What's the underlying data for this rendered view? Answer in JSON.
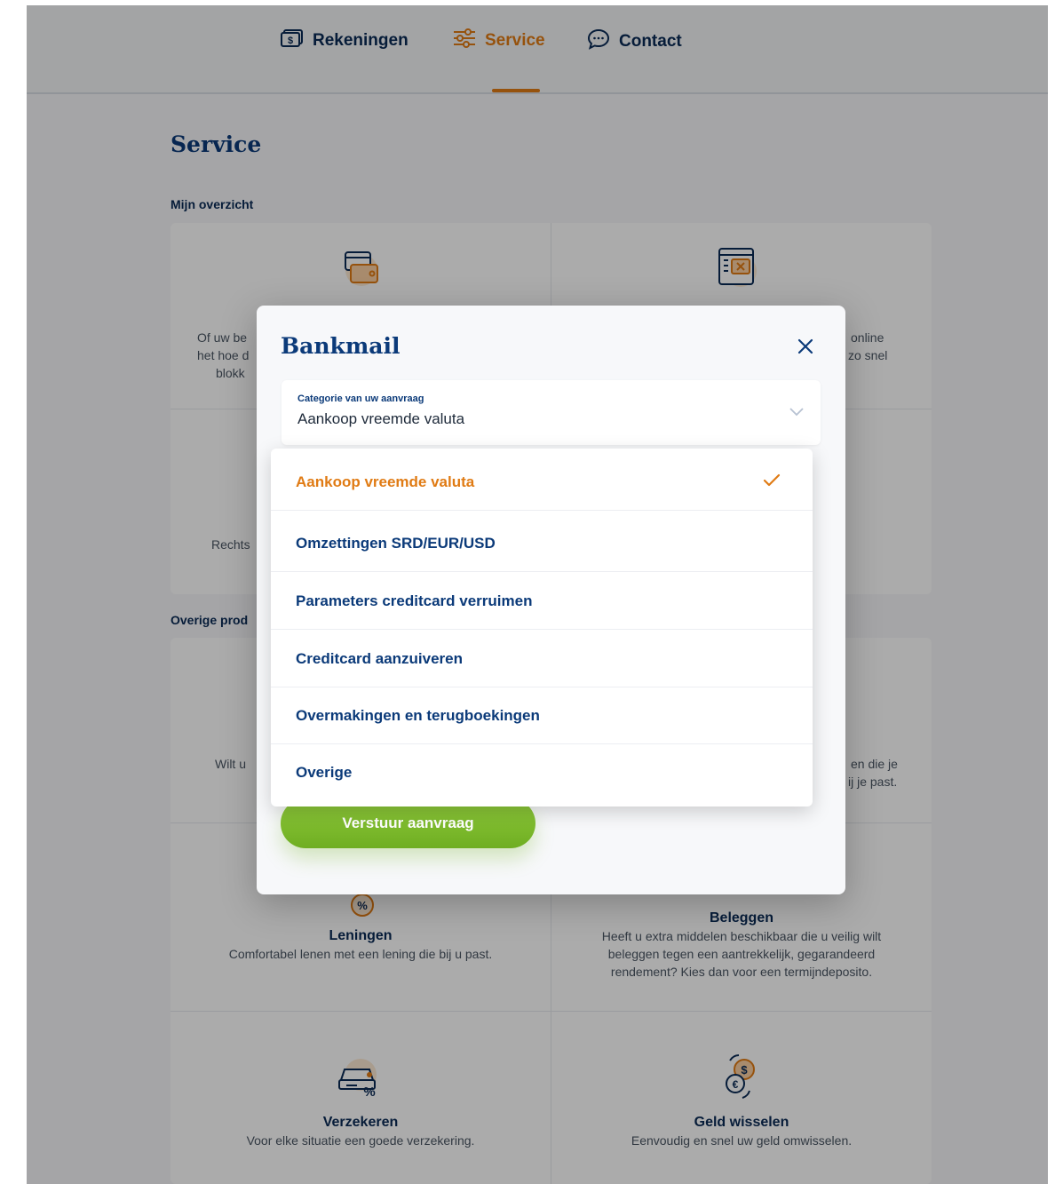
{
  "nav": {
    "items": [
      {
        "label": "Rekeningen",
        "icon": "bank-note-icon",
        "active": false
      },
      {
        "label": "Service",
        "icon": "sliders-icon",
        "active": true
      },
      {
        "label": "Contact",
        "icon": "chat-bubble-icon",
        "active": false
      }
    ],
    "accent_color": "#e07b14"
  },
  "page": {
    "title": "Service",
    "sections": {
      "overview": "Mijn overzicht",
      "other_products": "Overige prod"
    },
    "overview_cards": {
      "left_fragment_1": "Of uw be",
      "left_fragment_2": "het hoe d",
      "left_fragment_3": "blokk",
      "right_fragment_1": "online",
      "right_fragment_2": "zo snel",
      "left_fragment_4": "Rechts"
    },
    "other_cards": {
      "left_fragment": "Wilt u",
      "right_fragment_1": "en die je",
      "right_fragment_2": "ij je past."
    },
    "products": [
      {
        "title": "Leningen",
        "desc": "Comfortabel lenen met een lening die bij u past.",
        "icon": "percent-icon"
      },
      {
        "title": "Beleggen",
        "desc_1": "Heeft u extra middelen beschikbaar die u veilig wilt",
        "desc_2": "beleggen tegen een aantrekkelijk, gegarandeerd",
        "desc_3": "rendement? Kies dan voor een termijndeposito.",
        "icon": "investment-icon"
      },
      {
        "title": "Verzekeren",
        "desc": "Voor elke situatie een goede verzekering.",
        "icon": "car-insurance-icon"
      },
      {
        "title": "Geld wisselen",
        "desc": "Eenvoudig en snel uw geld omwisselen.",
        "icon": "currency-exchange-icon"
      }
    ]
  },
  "modal": {
    "title": "Bankmail",
    "select": {
      "label": "Categorie van uw aanvraag",
      "value": "Aankoop vreemde valuta"
    },
    "options": [
      {
        "label": "Aankoop vreemde valuta",
        "selected": true
      },
      {
        "label": "Omzettingen SRD/EUR/USD",
        "selected": false
      },
      {
        "label": "Parameters creditcard verruimen",
        "selected": false
      },
      {
        "label": "Creditcard aanzuiveren",
        "selected": false
      },
      {
        "label": "Overmakingen en terugboekingen",
        "selected": false
      },
      {
        "label": "Overige",
        "selected": false
      }
    ],
    "submit_label": "Verstuur aanvraag"
  }
}
